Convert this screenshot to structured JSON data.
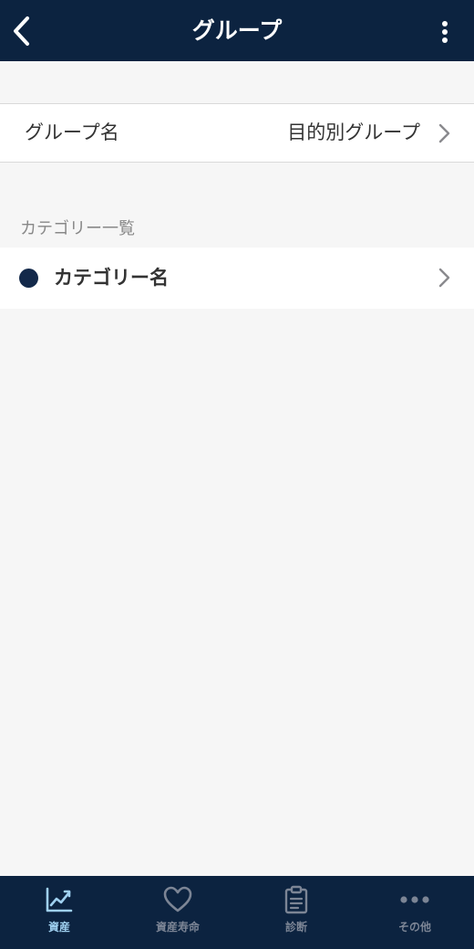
{
  "header": {
    "title": "グループ",
    "back_icon": "chevron-left-icon",
    "more_icon": "more-vertical-icon"
  },
  "group": {
    "label": "グループ名",
    "value": "目的別グループ"
  },
  "categories": {
    "section_title": "カテゴリー一覧",
    "items": [
      {
        "label": "カテゴリー名",
        "color": "#13294a"
      }
    ]
  },
  "tabbar": {
    "tabs": [
      {
        "label": "資産",
        "icon": "chart-line-icon",
        "active": true
      },
      {
        "label": "資産寿命",
        "icon": "heart-icon",
        "active": false
      },
      {
        "label": "診断",
        "icon": "clipboard-icon",
        "active": false
      },
      {
        "label": "その他",
        "icon": "more-horizontal-icon",
        "active": false
      }
    ]
  },
  "colors": {
    "header_bg": "#0c2340",
    "tab_active": "#9fd0f0",
    "tab_inactive": "#7c8595",
    "background": "#f6f6f6"
  }
}
